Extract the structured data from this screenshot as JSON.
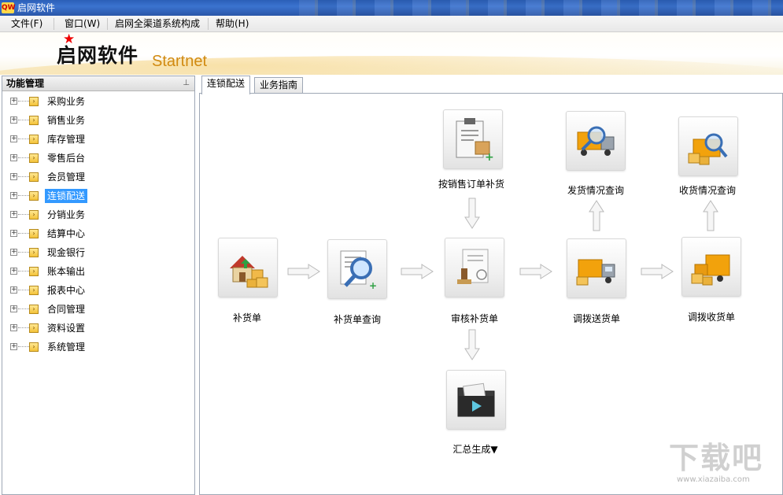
{
  "window": {
    "title": "启网软件",
    "icon_text": "QW"
  },
  "menu": [
    {
      "label": "文件(F)"
    },
    {
      "label": "窗口(W)"
    },
    {
      "label": "启网全渠道系统构成"
    },
    {
      "label": "帮助(H)"
    }
  ],
  "banner": {
    "brand_cn": "启网软件",
    "brand_en": "Startnet"
  },
  "sidebar": {
    "title": "功能管理",
    "pin_glyph": "⊥",
    "items": [
      {
        "label": "采购业务"
      },
      {
        "label": "销售业务"
      },
      {
        "label": "库存管理"
      },
      {
        "label": "零售后台"
      },
      {
        "label": "会员管理"
      },
      {
        "label": "连锁配送"
      },
      {
        "label": "分销业务"
      },
      {
        "label": "结算中心"
      },
      {
        "label": "现金银行"
      },
      {
        "label": "账本输出"
      },
      {
        "label": "报表中心"
      },
      {
        "label": "合同管理"
      },
      {
        "label": "资料设置"
      },
      {
        "label": "系统管理"
      }
    ],
    "selected_index": 5
  },
  "tabs": [
    {
      "label": "连锁配送",
      "active": true
    },
    {
      "label": "业务指南",
      "active": false
    }
  ],
  "flow": {
    "nodes": {
      "replenish_order": {
        "label": "补货单",
        "icon": "house-boxes-icon"
      },
      "replenish_query": {
        "label": "补货单查询",
        "icon": "document-magnifier-icon"
      },
      "review_replenish": {
        "label": "审核补货单",
        "icon": "stamp-document-icon"
      },
      "transfer_send": {
        "label": "调拨送货单",
        "icon": "truck-icon"
      },
      "transfer_receive": {
        "label": "调拨收货单",
        "icon": "truck-boxes-icon"
      },
      "sales_order_replenish": {
        "label": "按销售订单补货",
        "icon": "clipboard-icon"
      },
      "shipping_query": {
        "label": "发货情况查询",
        "icon": "truck-magnifier-icon"
      },
      "receiving_query": {
        "label": "收货情况查询",
        "icon": "boxes-magnifier-icon"
      },
      "summary_generate": {
        "label": "汇总生成▼",
        "icon": "folder-play-icon"
      }
    }
  },
  "watermark": {
    "text": "下载吧",
    "sub": "www.xiazaiba.com"
  },
  "colors": {
    "selected": "#3399ff",
    "brand_accent": "#d18a10",
    "star": "#ee0000"
  }
}
